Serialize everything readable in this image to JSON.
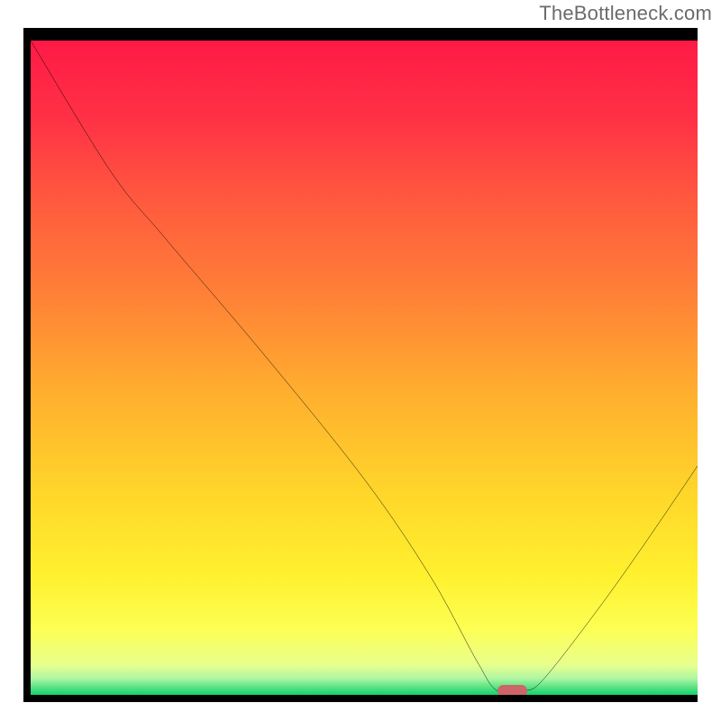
{
  "watermark": "TheBottleneck.com",
  "colors": {
    "curve": "#000000",
    "marker": "#cd6569",
    "frame": "#000000"
  },
  "chart_data": {
    "type": "line",
    "title": "",
    "xlabel": "",
    "ylabel": "",
    "xlim": [
      0,
      100
    ],
    "ylim": [
      0,
      100
    ],
    "grid": false,
    "legend": false,
    "description": "Bottleneck/mismatch percentage (y, 0 at bottom = optimal, 100 at top = worst) across a hardware-balance axis (x). Curve drops toward zero near the optimal pairing and rises on either side.",
    "curve_points": [
      {
        "x": 0.0,
        "y": 100.0
      },
      {
        "x": 12.0,
        "y": 80.0
      },
      {
        "x": 20.0,
        "y": 70.0
      },
      {
        "x": 35.0,
        "y": 52.0
      },
      {
        "x": 50.0,
        "y": 33.0
      },
      {
        "x": 60.0,
        "y": 18.0
      },
      {
        "x": 67.0,
        "y": 5.0
      },
      {
        "x": 70.0,
        "y": 0.6
      },
      {
        "x": 74.0,
        "y": 0.6
      },
      {
        "x": 77.0,
        "y": 2.5
      },
      {
        "x": 85.0,
        "y": 13.0
      },
      {
        "x": 92.0,
        "y": 23.0
      },
      {
        "x": 100.0,
        "y": 35.0
      }
    ],
    "optimal_range": {
      "x_start": 70.0,
      "x_end": 74.5,
      "y": 0.6
    },
    "marker_height_frac": 0.018
  }
}
